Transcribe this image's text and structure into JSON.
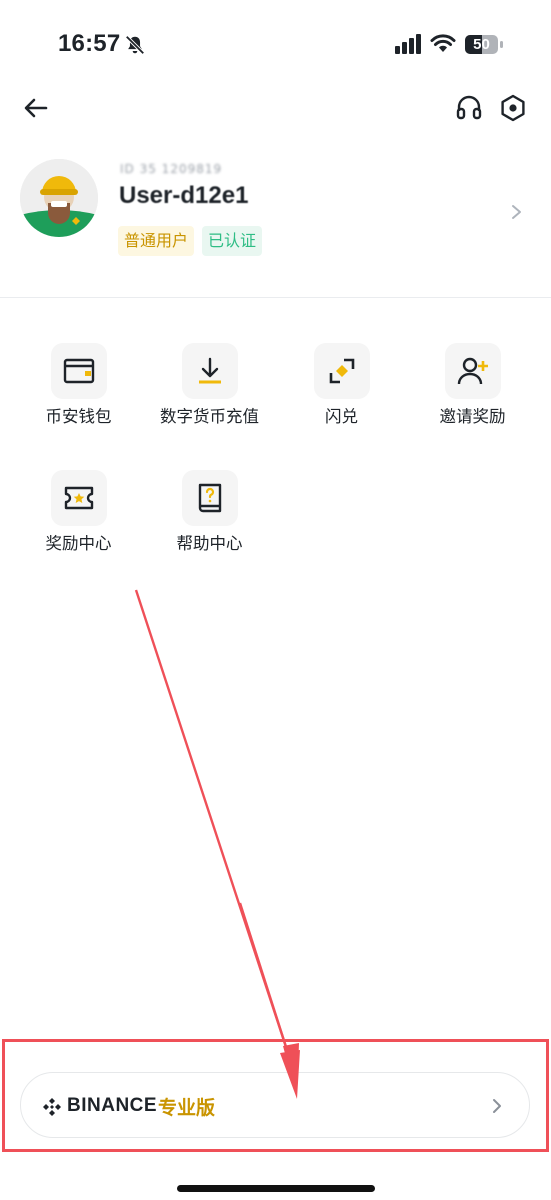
{
  "status_bar": {
    "time": "16:57",
    "battery": "50",
    "icons": [
      "bell-off-icon",
      "signal-icon",
      "wifi-icon",
      "battery-icon"
    ]
  },
  "nav": {
    "icons": [
      "back-arrow-icon",
      "headset-icon",
      "settings-hexagon-icon"
    ]
  },
  "profile": {
    "user_id": "ID 35 1209819",
    "user_name": "User-d12e1",
    "badges": [
      "普通用户",
      "已认证"
    ]
  },
  "shortcuts": [
    {
      "label": "币安钱包",
      "icon": "wallet-icon"
    },
    {
      "label": "数字货币充值",
      "icon": "deposit-icon"
    },
    {
      "label": "闪兑",
      "icon": "convert-icon"
    },
    {
      "label": "邀请奖励",
      "icon": "invite-icon"
    },
    {
      "label": "奖励中心",
      "icon": "ticket-icon"
    },
    {
      "label": "帮助中心",
      "icon": "help-book-icon"
    }
  ],
  "pro_banner": {
    "brand": "BINANCE",
    "label": "专业版",
    "icon": "binance-logo-icon"
  },
  "colors": {
    "accent": "#F0B90B",
    "gold_text": "#C99400",
    "verified": "#2EBD85",
    "annotation": "#EF5058"
  }
}
